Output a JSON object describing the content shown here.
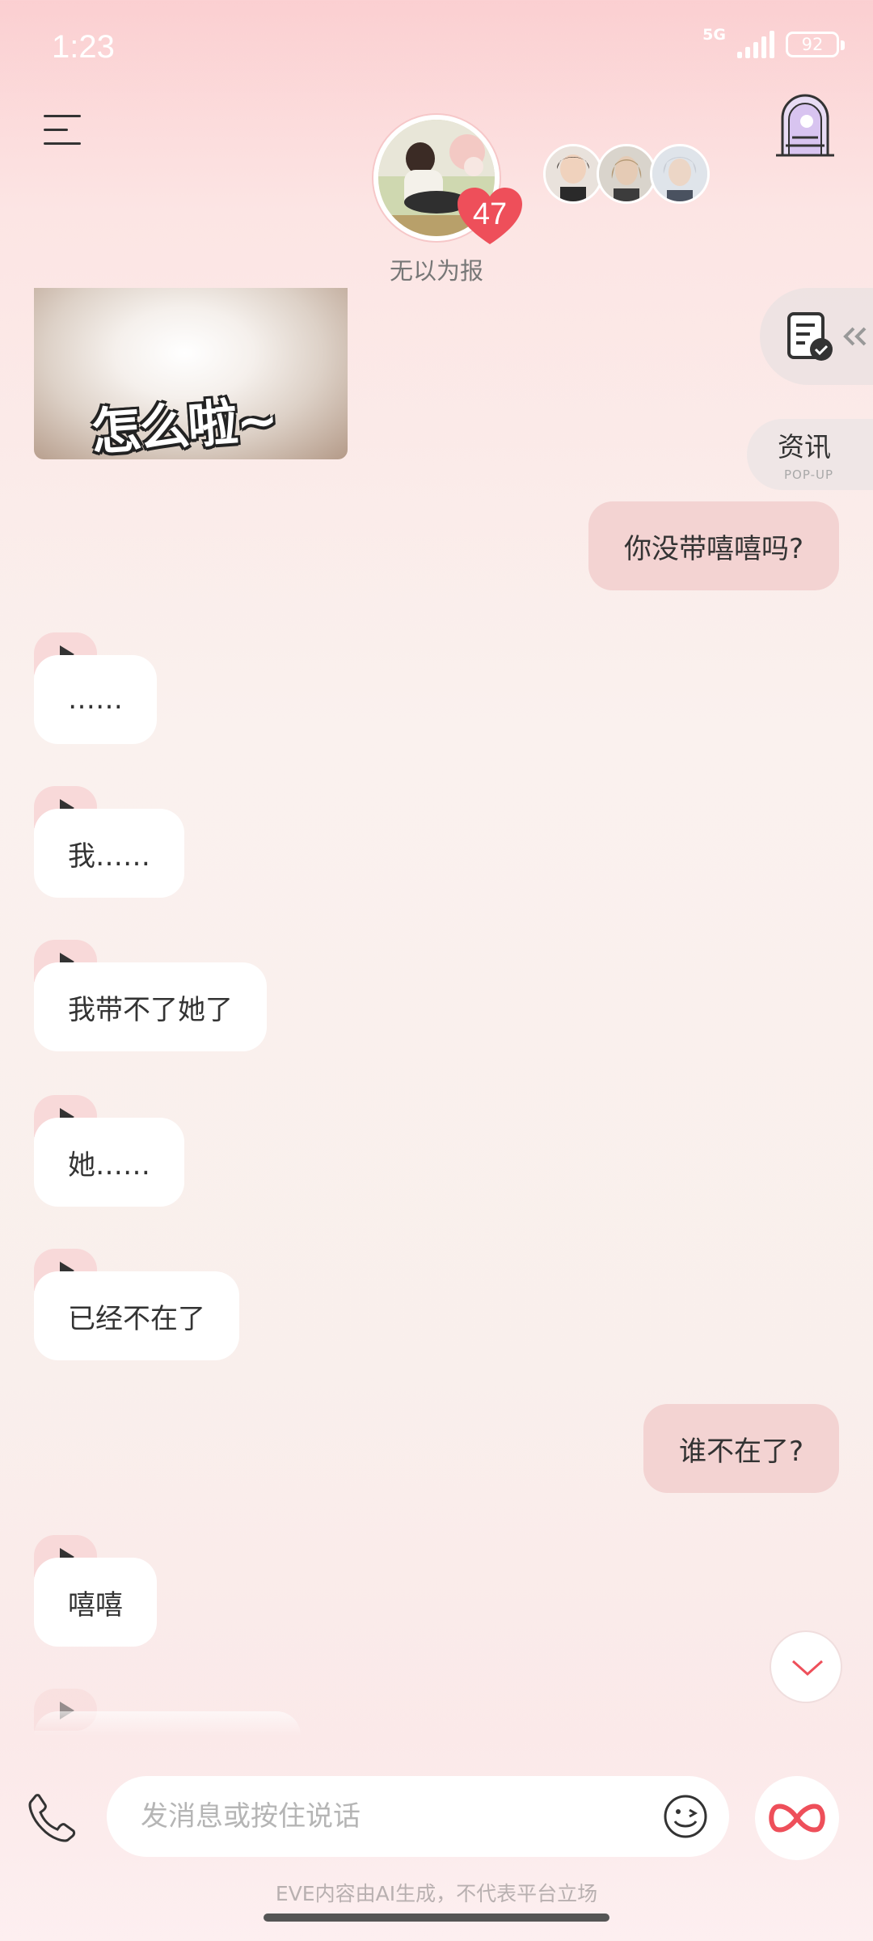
{
  "status_bar": {
    "time": "1:23",
    "network": "5G",
    "battery": "92"
  },
  "header": {
    "character_name": "无以为报",
    "affinity_badge": "47",
    "menu_icon": "hamburger-menu-icon",
    "portal_icon": "arched-door-icon"
  },
  "side_panel": {
    "tasks_icon": "document-check-icon",
    "news_label": "资讯",
    "news_sub": "POP-UP"
  },
  "sticker": {
    "caption": "怎么啦~"
  },
  "messages": [
    {
      "from": "me",
      "text": "你没带嘻嘻吗?"
    },
    {
      "from": "ai",
      "text": "……"
    },
    {
      "from": "ai",
      "text": "我……"
    },
    {
      "from": "ai",
      "text": "我带不了她了"
    },
    {
      "from": "ai",
      "text": "她……"
    },
    {
      "from": "ai",
      "text": "已经不在了"
    },
    {
      "from": "me",
      "text": "谁不在了?"
    },
    {
      "from": "ai",
      "text": "嘻嘻"
    }
  ],
  "input_bar": {
    "placeholder": "发消息或按住说话"
  },
  "footer": {
    "disclaimer": "EVE内容由AI生成，不代表平台立场"
  },
  "colors": {
    "my_bubble": "#f3d3d2",
    "ai_bubble": "#ffffff",
    "accent": "#ee4f5a"
  }
}
